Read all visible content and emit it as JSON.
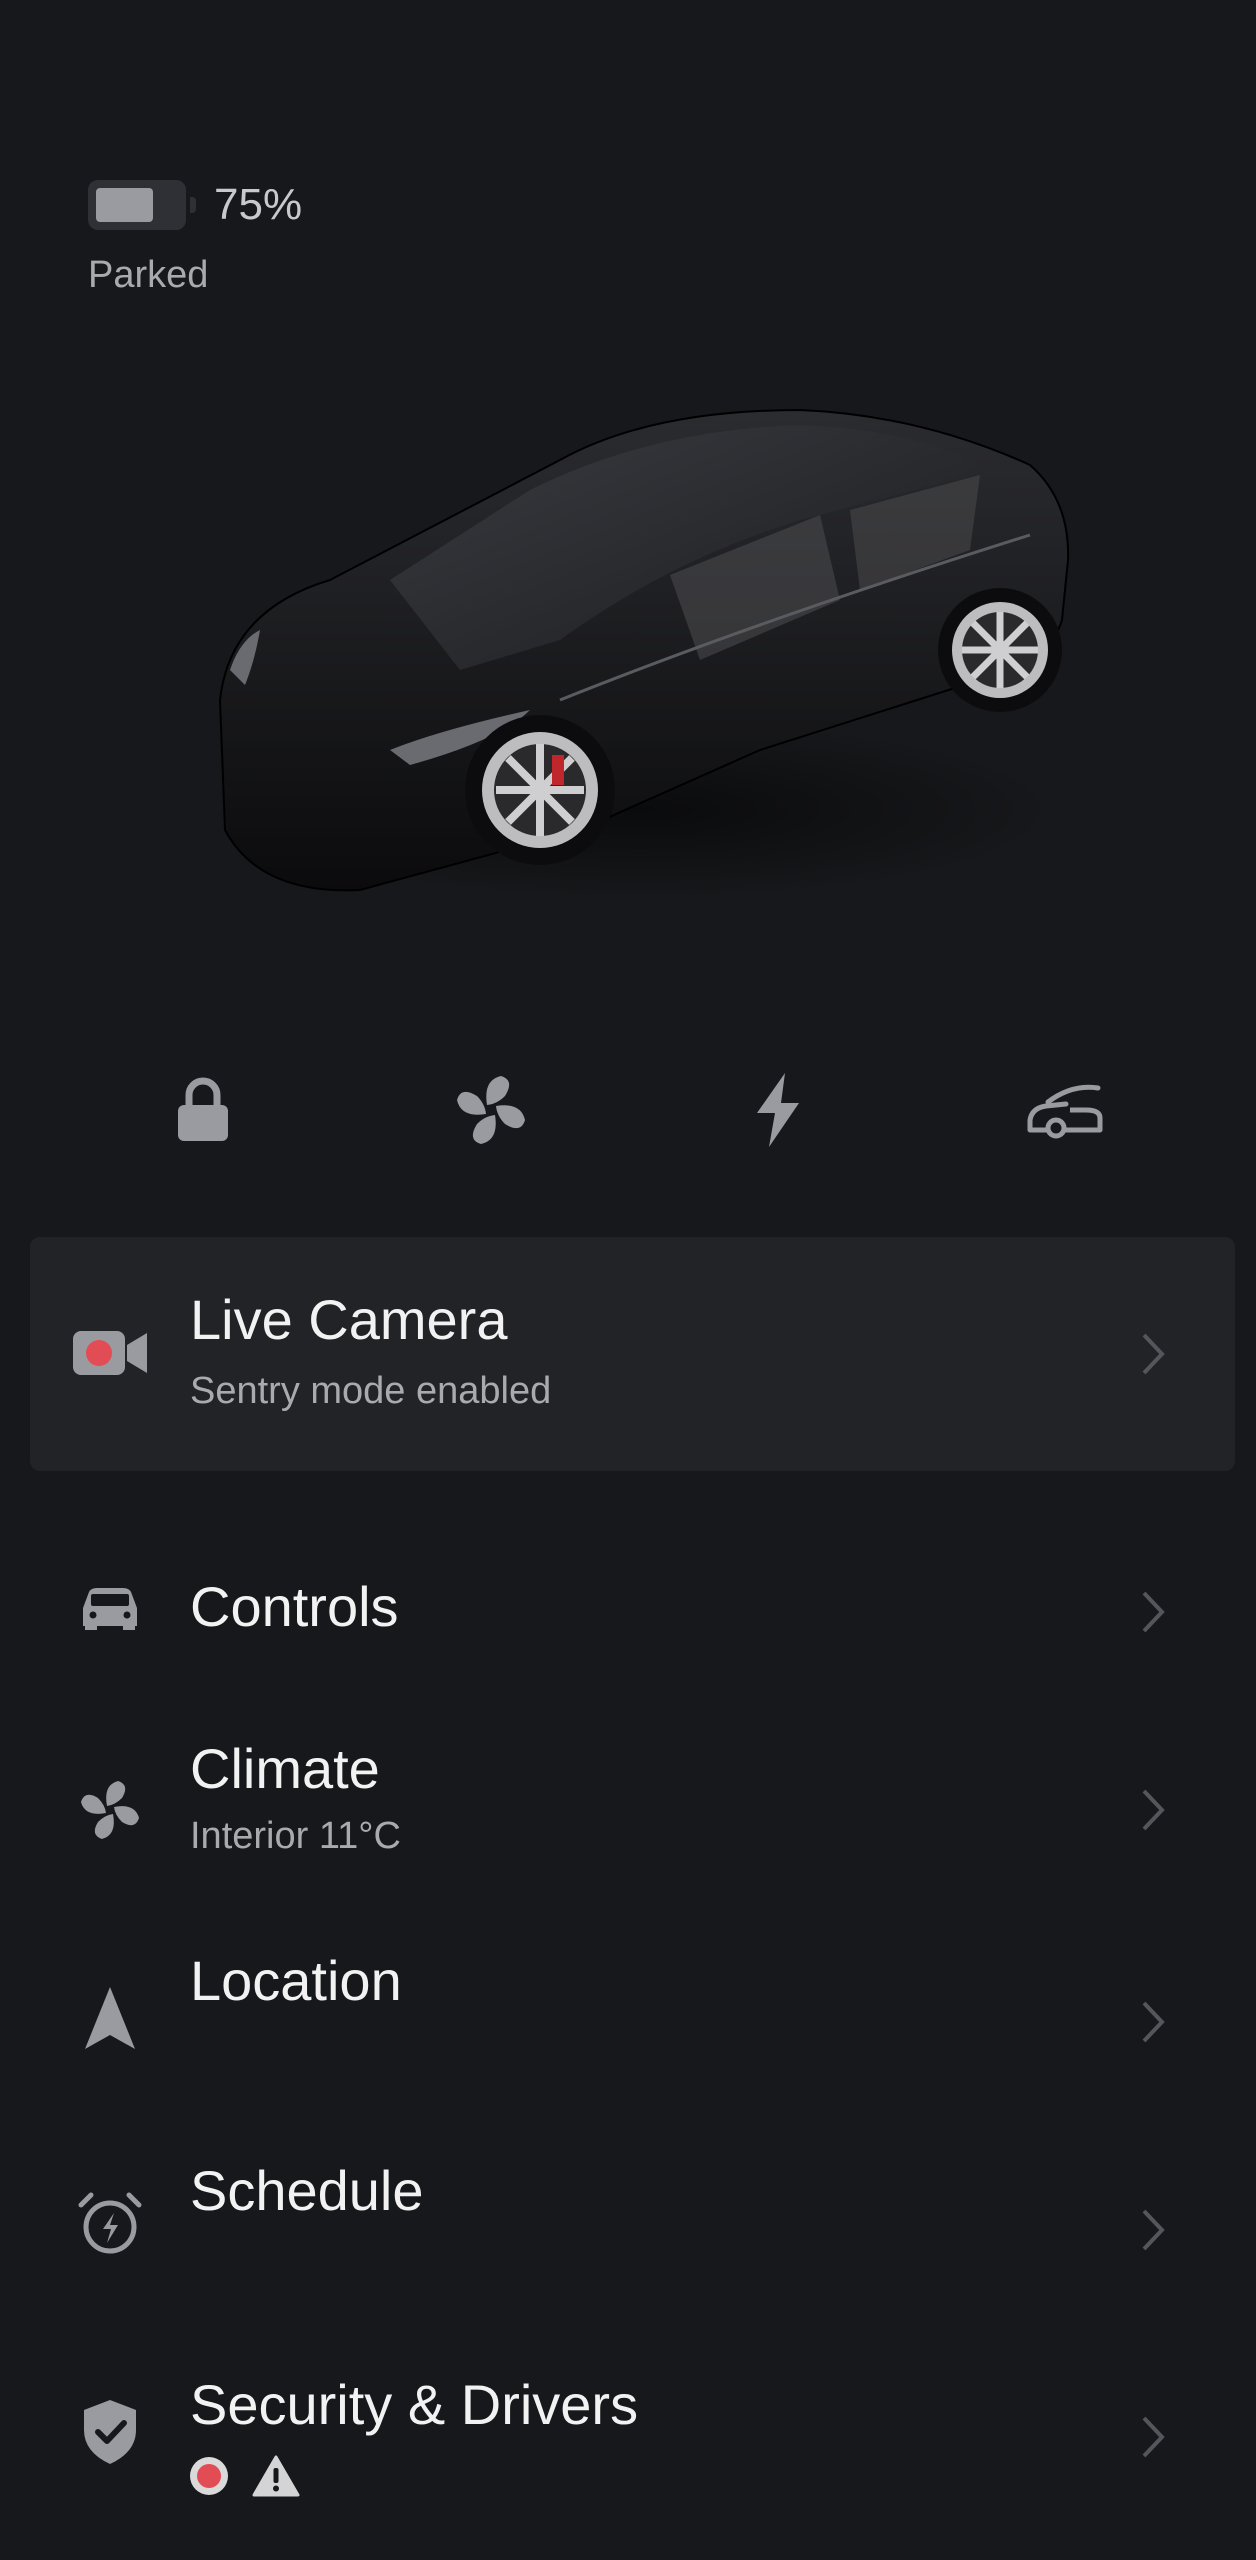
{
  "status": {
    "battery_percent": "75%",
    "battery_level": 0.75,
    "state": "Parked"
  },
  "quick_actions": [
    {
      "name": "lock",
      "icon": "lock-icon"
    },
    {
      "name": "climate",
      "icon": "fan-icon"
    },
    {
      "name": "charge",
      "icon": "lightning-bolt-icon"
    },
    {
      "name": "frunk",
      "icon": "frunk-open-icon"
    }
  ],
  "live_camera": {
    "title": "Live Camera",
    "subtitle": "Sentry mode enabled",
    "icon": "video-camera-icon"
  },
  "menu": {
    "controls": {
      "title": "Controls",
      "icon": "car-icon"
    },
    "climate": {
      "title": "Climate",
      "subtitle": "Interior 11°C",
      "icon": "fan-icon"
    },
    "location": {
      "title": "Location",
      "icon": "navigation-arrow-icon"
    },
    "schedule": {
      "title": "Schedule",
      "icon": "alarm-clock-bolt-icon"
    },
    "security": {
      "title": "Security & Drivers",
      "icon": "shield-check-icon",
      "alerts": [
        "record-dot-icon",
        "warning-triangle-icon"
      ]
    }
  },
  "colors": {
    "background": "#17181b",
    "card": "#222326",
    "icon": "#9a9ba0",
    "record_red": "#e24c55"
  }
}
